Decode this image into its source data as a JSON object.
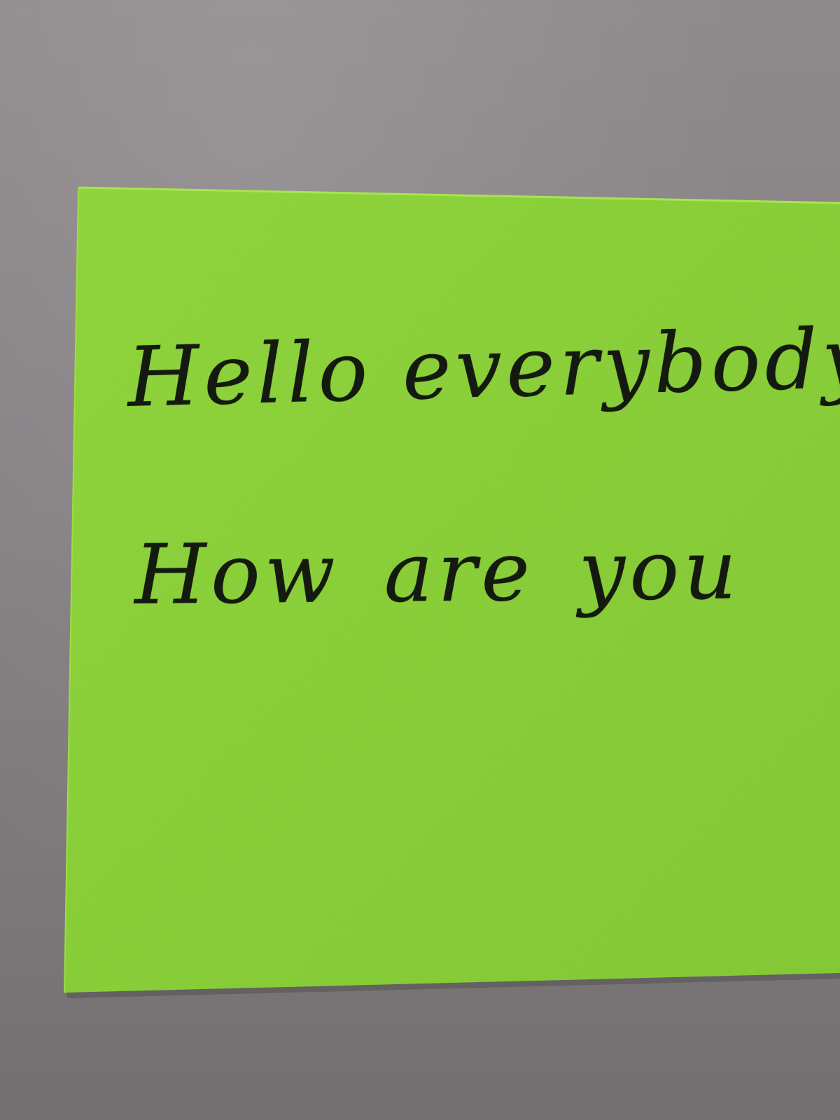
{
  "scene": {
    "wall_color": "#8a8587",
    "note_color": "#8cd43a",
    "note_edge_color": "#a6e24e"
  },
  "note": {
    "line_1": "Hello everybody",
    "line_2": "How are you"
  }
}
